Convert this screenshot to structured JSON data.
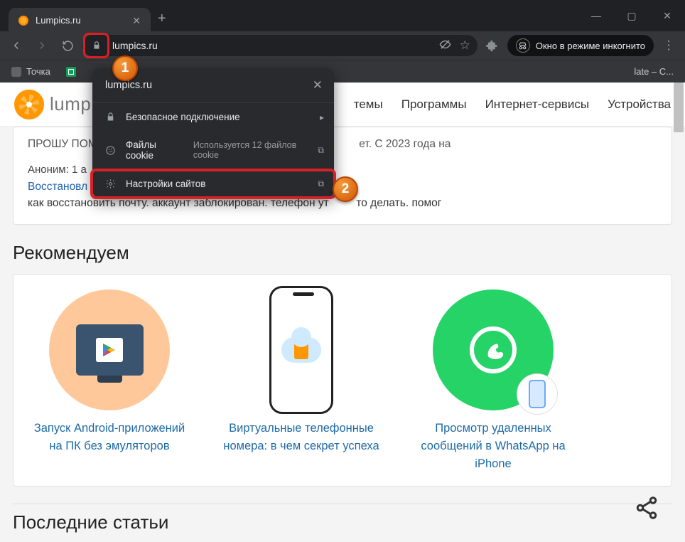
{
  "window": {
    "minimize": "—",
    "maximize": "▢",
    "close": "✕"
  },
  "tab": {
    "title": "Lumpics.ru",
    "close": "✕",
    "new_tab": "+"
  },
  "toolbar": {
    "url": "lumpics.ru",
    "incognito_label": "Окно в режиме инкогнито"
  },
  "bookmarks": {
    "item1": "Точка",
    "item2_truncated": "late – C..."
  },
  "popup": {
    "host": "lumpics.ru",
    "close": "✕",
    "secure": "Безопасное подключение",
    "cookies_label": "Файлы cookie",
    "cookies_sub": "Используется 12 файлов cookie",
    "site_settings": "Настройки сайтов",
    "chevron": "▸",
    "ext_icon": "⧉"
  },
  "steps": {
    "one": "1",
    "two": "2"
  },
  "site": {
    "logo_text": "lumpics",
    "nav0_trunc": "темы",
    "nav1": "Программы",
    "nav2": "Интернет-сервисы",
    "nav3": "Устройства"
  },
  "comments": {
    "line1_trunc": "ПРОШУ ПОМ",
    "line1b_trunc": "ет. С 2023 года на",
    "anon": "Аноним: 1 а",
    "link": "Восстановл",
    "body": "как восстановить почту. аккаунт заблокирован. телефон ут",
    "body_end": "то делать. помог"
  },
  "recommend": {
    "title": "Рекомендуем",
    "card1": "Запуск Android-приложений на ПК без эмуляторов",
    "card2": "Виртуальные телефонные номера: в чем секрет успеха",
    "card3": "Просмотр удаленных сообщений в WhatsApp на iPhone"
  },
  "latest": {
    "title": "Последние статьи"
  }
}
